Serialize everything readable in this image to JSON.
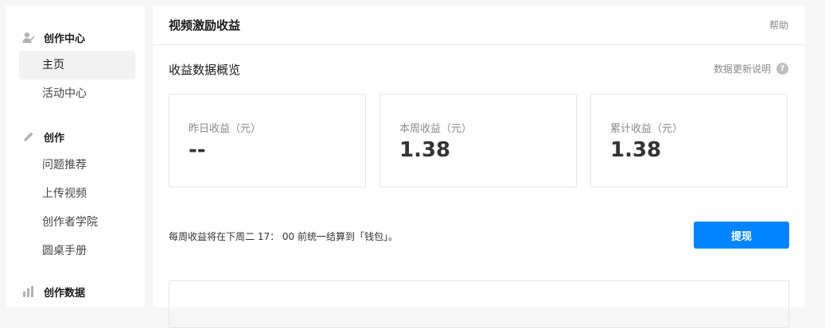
{
  "sidebar": {
    "sections": [
      {
        "title": "创作中心",
        "icon": "user-icon",
        "items": [
          {
            "label": "主页",
            "active": true
          },
          {
            "label": "活动中心",
            "active": false
          }
        ]
      },
      {
        "title": "创作",
        "icon": "pencil-icon",
        "items": [
          {
            "label": "问题推荐",
            "active": false
          },
          {
            "label": "上传视频",
            "active": false
          },
          {
            "label": "创作者学院",
            "active": false
          },
          {
            "label": "圆桌手册",
            "active": false
          }
        ]
      },
      {
        "title": "创作数据",
        "icon": "chart-icon",
        "items": []
      }
    ]
  },
  "main": {
    "title": "视频激励收益",
    "help": "帮助",
    "overview_title": "收益数据概览",
    "update_note": "数据更新说明",
    "stats": [
      {
        "label": "昨日收益（元）",
        "value": "--"
      },
      {
        "label": "本周收益（元）",
        "value": "1.38"
      },
      {
        "label": "累计收益（元）",
        "value": "1.38"
      }
    ],
    "settle_note": "每周收益将在下周二 17： 00 前统一结算到「钱包」。",
    "withdraw_label": "提现"
  },
  "colors": {
    "accent": "#0084ff",
    "page_bg": "#f6f6f6"
  }
}
